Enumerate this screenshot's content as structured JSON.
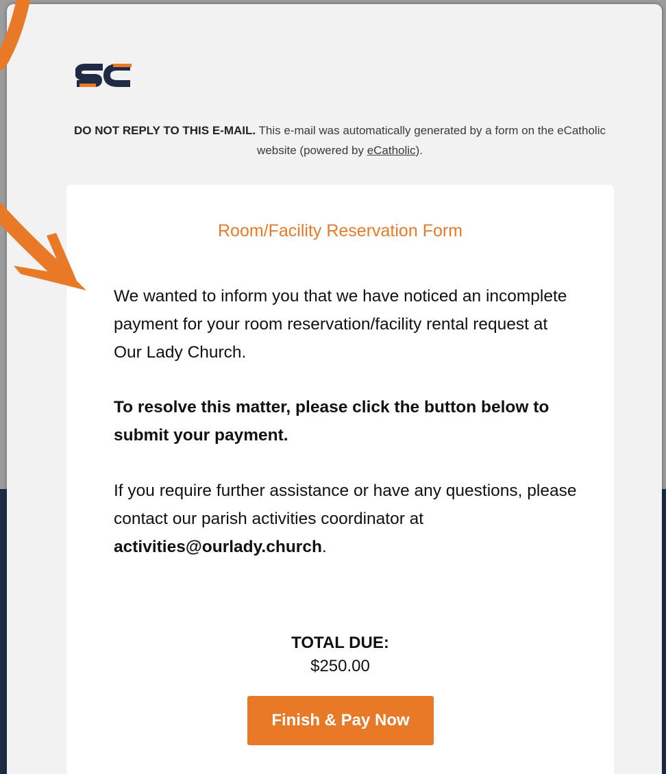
{
  "colors": {
    "accent": "#e87a27",
    "logo_navy": "#1f2b44",
    "page_background_dark": "#1f2b44",
    "email_background": "#f2f2f2",
    "card_background": "#ffffff"
  },
  "header": {
    "logo_icon": "sc-logo-icon",
    "logo_text": "SC",
    "notice_bold": "DO NOT REPLY TO THIS E-MAIL.",
    "notice_text": " This e-mail was automatically generated by a form on the eCatholic website (powered by ",
    "notice_link": "eCatholic",
    "notice_end": ")."
  },
  "card": {
    "title": "Room/Facility Reservation Form",
    "paragraph1": "We wanted to inform you that we have noticed an incomplete payment for your room reservation/facility rental request at Our Lady Church.",
    "paragraph2": "To resolve this matter, please click the button below to submit your payment.",
    "paragraph3_text": "If you require further assistance or have any questions, please contact our parish activities coordinator at ",
    "paragraph3_email": "activities@ourlady.church",
    "paragraph3_end": ".",
    "total_label": "TOTAL DUE:",
    "total_amount": "$250.00",
    "pay_button_label": "Finish & Pay Now"
  },
  "overlay": {
    "arrow_icon": "curved-arrow-icon",
    "arrow_color": "#e87a27"
  }
}
